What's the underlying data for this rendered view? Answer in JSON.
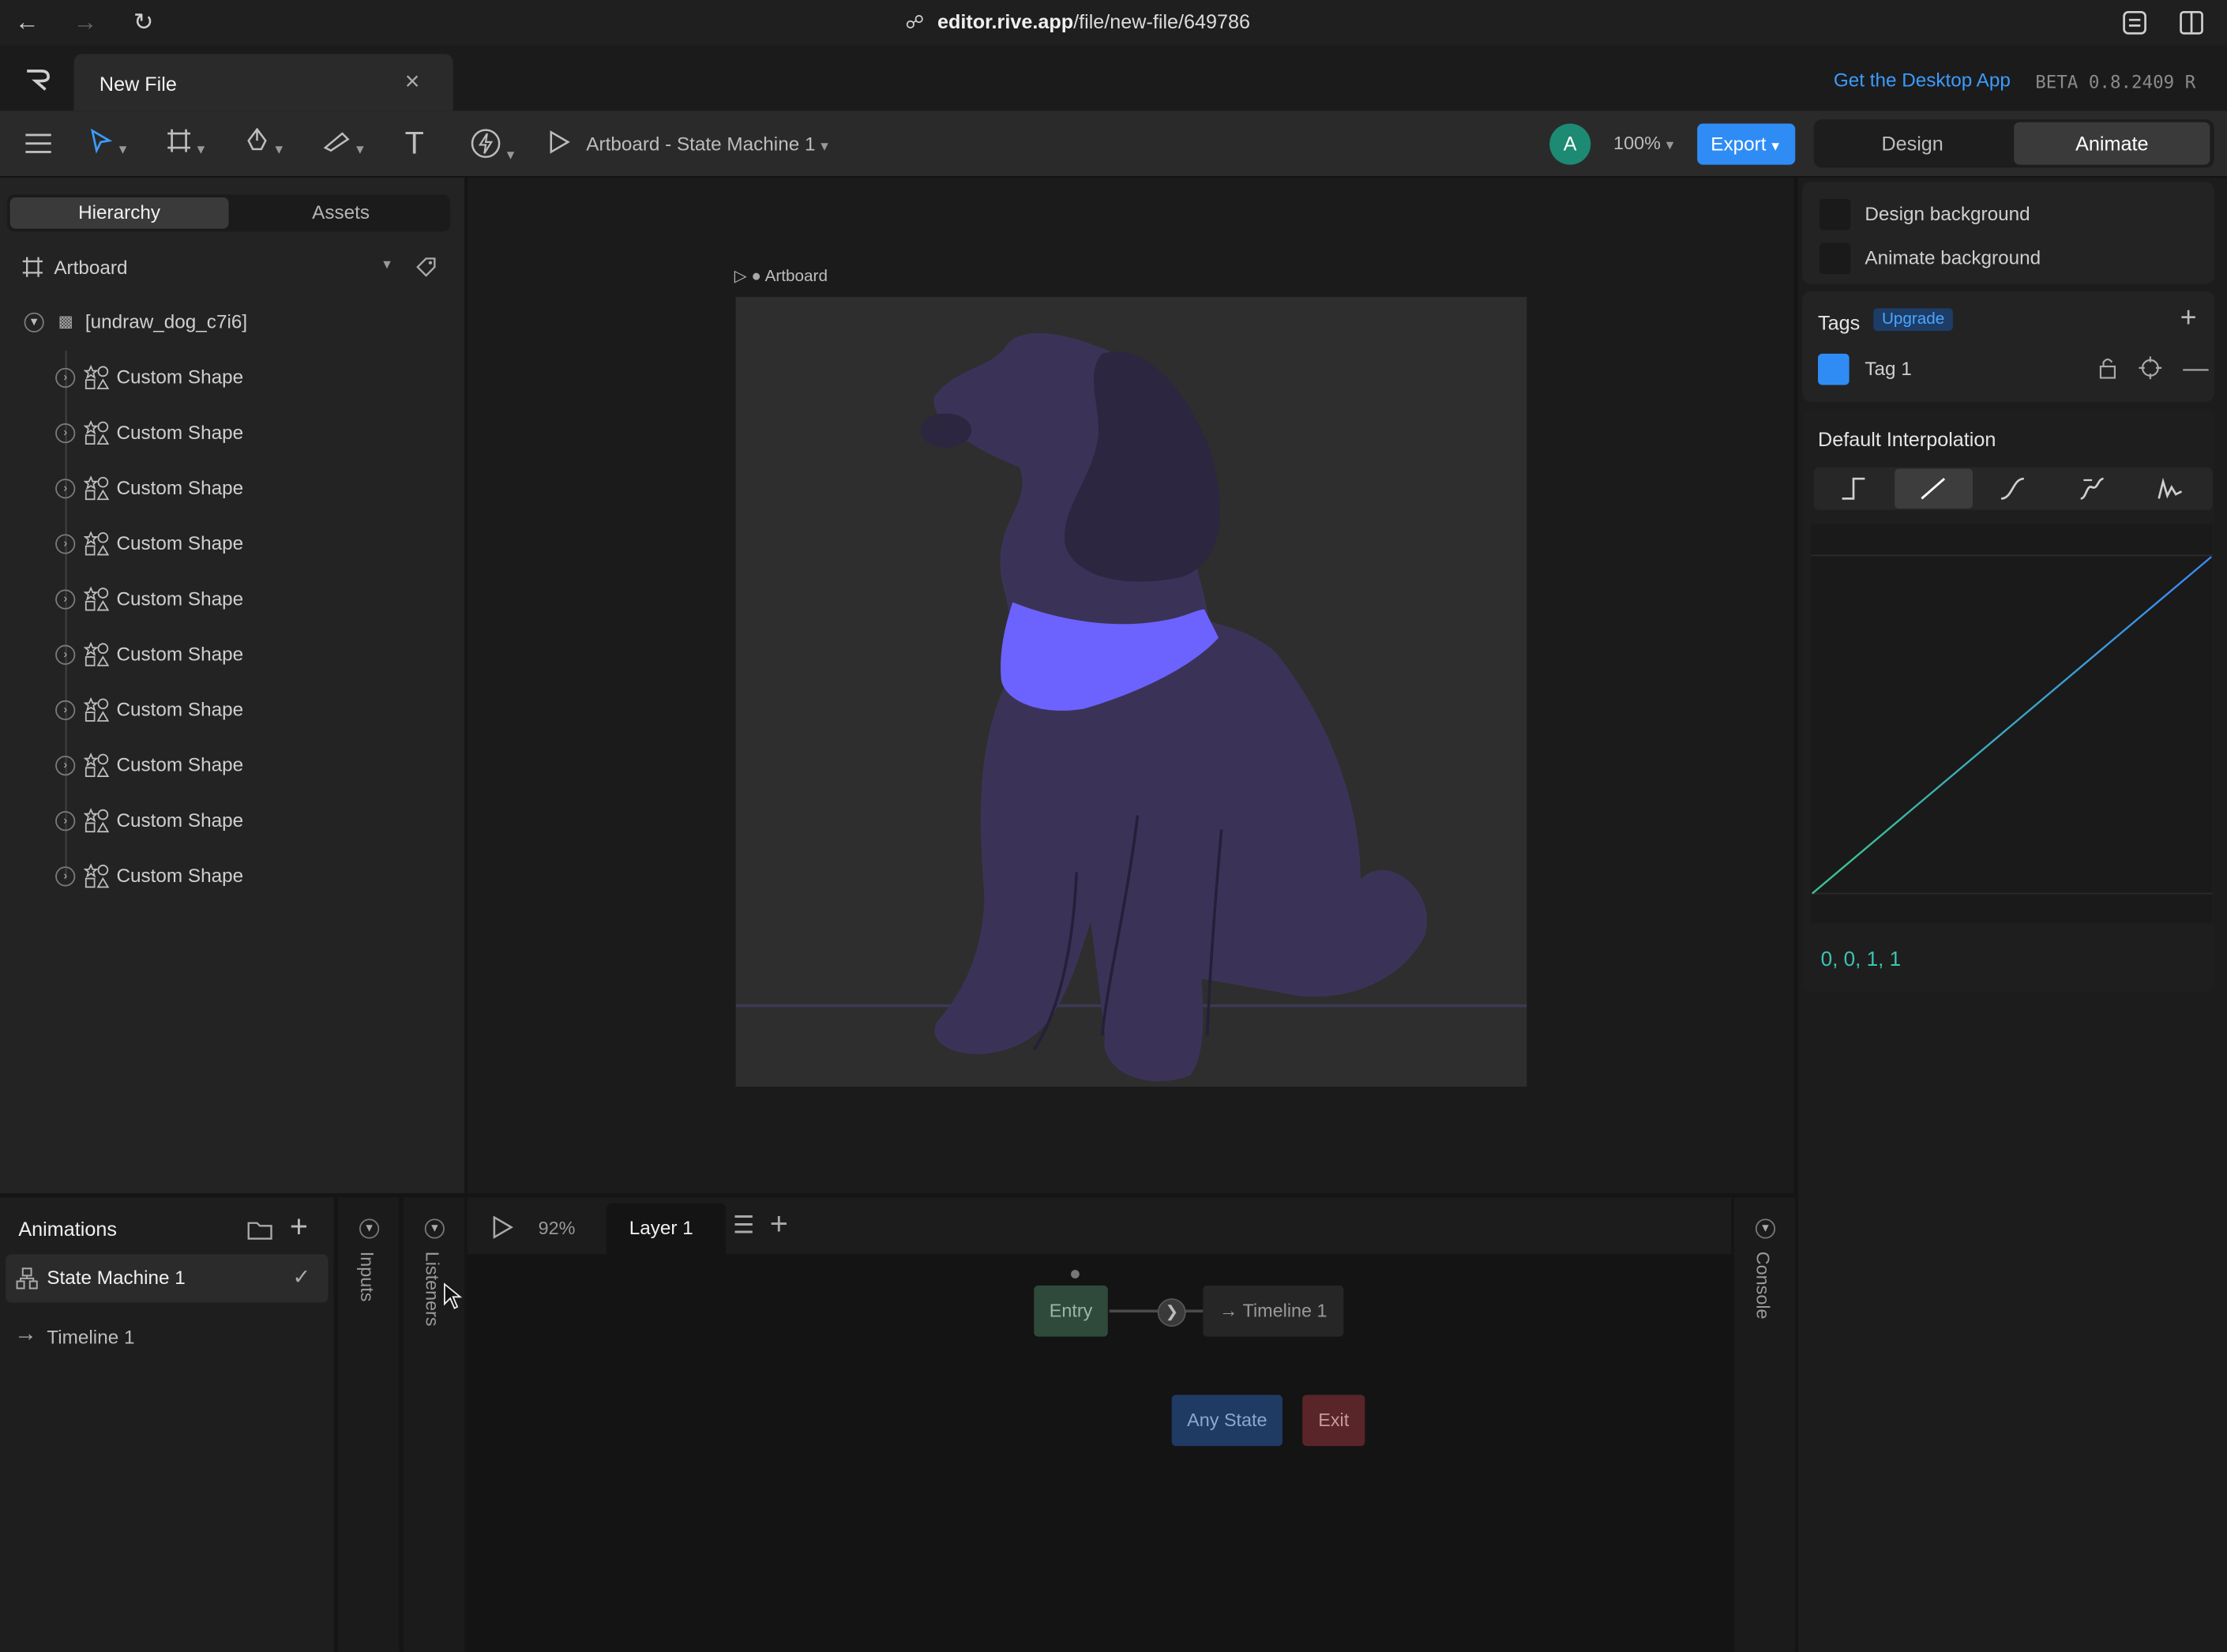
{
  "browser": {
    "url_host": "editor.rive.app",
    "url_path": "/file/new-file/649786"
  },
  "tab": {
    "title": "New File",
    "desktop_link": "Get the Desktop App",
    "version": "BETA 0.8.2409 R"
  },
  "toolbar": {
    "state_machine_title": "Artboard - State Machine 1",
    "avatar_letter": "A",
    "zoom": "100%",
    "export_label": "Export",
    "mode_design": "Design",
    "mode_animate": "Animate"
  },
  "hierarchy": {
    "tab_hierarchy": "Hierarchy",
    "tab_assets": "Assets",
    "artboard": "Artboard",
    "group": "[undraw_dog_c7i6]",
    "items": [
      "Custom Shape",
      "Custom Shape",
      "Custom Shape",
      "Custom Shape",
      "Custom Shape",
      "Custom Shape",
      "Custom Shape",
      "Custom Shape",
      "Custom Shape",
      "Custom Shape"
    ]
  },
  "stage": {
    "artboard_label": "Artboard"
  },
  "right_panel": {
    "design_bg": "Design background",
    "animate_bg": "Animate background",
    "tags_title": "Tags",
    "upgrade": "Upgrade",
    "tag_name": "Tag 1",
    "tag_color": "#2f8cf5",
    "interp_title": "Default Interpolation",
    "curve_values": "0, 0, 1, 1"
  },
  "animations": {
    "title": "Animations",
    "items": [
      {
        "label": "State Machine 1",
        "selected": true
      },
      {
        "label": "Timeline 1",
        "selected": false
      }
    ]
  },
  "strips": {
    "inputs": "Inputs",
    "listeners": "Listeners",
    "console": "Console"
  },
  "graph": {
    "zoom": "92%",
    "layer": "Layer 1",
    "nodes": {
      "entry": "Entry",
      "timeline": "Timeline 1",
      "any_state": "Any State",
      "exit": "Exit"
    }
  },
  "colors": {
    "accent": "#2f8cf5",
    "dog_body": "#3b3357",
    "dog_ear": "#2c2640",
    "collar": "#6c63ff",
    "entry_node": "#2f4a3b",
    "any_state_node": "#1f3a63",
    "exit_node": "#5a2528"
  }
}
